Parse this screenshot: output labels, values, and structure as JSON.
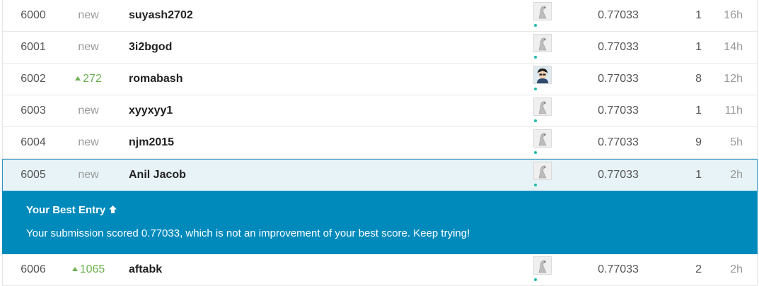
{
  "leaderboard": {
    "rows": [
      {
        "rank": "6000",
        "delta": "new",
        "delta_dir": "new",
        "team": "suyash2702",
        "avatar": "goose-icon",
        "score": "0.77033",
        "entries": "1",
        "last": "16h"
      },
      {
        "rank": "6001",
        "delta": "new",
        "delta_dir": "new",
        "team": "3i2bgod",
        "avatar": "goose-icon",
        "score": "0.77033",
        "entries": "1",
        "last": "14h"
      },
      {
        "rank": "6002",
        "delta": "272",
        "delta_dir": "up",
        "team": "romabash",
        "avatar": "user-photo-icon",
        "score": "0.77033",
        "entries": "8",
        "last": "12h"
      },
      {
        "rank": "6003",
        "delta": "new",
        "delta_dir": "new",
        "team": "xyyxyy1",
        "avatar": "goose-icon",
        "score": "0.77033",
        "entries": "1",
        "last": "11h"
      },
      {
        "rank": "6004",
        "delta": "new",
        "delta_dir": "new",
        "team": "njm2015",
        "avatar": "goose-icon",
        "score": "0.77033",
        "entries": "9",
        "last": "5h"
      },
      {
        "rank": "6005",
        "delta": "new",
        "delta_dir": "new",
        "team": "Anil Jacob",
        "avatar": "goose-icon",
        "score": "0.77033",
        "entries": "1",
        "last": "2h"
      },
      {
        "rank": "6006",
        "delta": "1065",
        "delta_dir": "up",
        "team": "aftabk",
        "avatar": "goose-icon",
        "score": "0.77033",
        "entries": "2",
        "last": "2h"
      }
    ]
  },
  "banner": {
    "title": "Your Best Entry",
    "title_icon": "arrow-up-icon",
    "message": "Your submission scored 0.77033, which is not an improvement of your best score. Keep trying!"
  },
  "colors": {
    "banner_bg": "#008abc",
    "highlight_bg": "#e8f3f7",
    "highlight_border": "#2b94c4",
    "up_green": "#6ab150",
    "dot_teal": "#20beab"
  }
}
